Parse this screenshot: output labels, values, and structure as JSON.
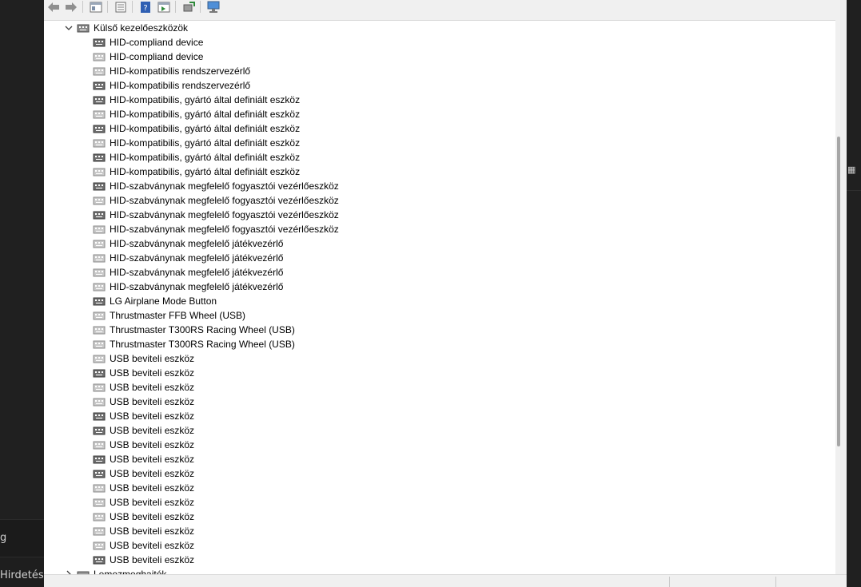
{
  "background": {
    "left_text_1": "g",
    "left_text_2": "Hirdetés"
  },
  "toolbar": {
    "buttons": [
      "back-icon",
      "forward-icon",
      "console-tree-icon",
      "properties-icon",
      "help-icon",
      "action-pane-icon",
      "scan-hardware-icon",
      "monitor-icon"
    ]
  },
  "tree": {
    "category": {
      "label": "Külső kezelőeszközök",
      "expanded": true
    },
    "devices": [
      {
        "label": "HID-compliand device",
        "icon": "dark"
      },
      {
        "label": "HID-compliand device",
        "icon": "light"
      },
      {
        "label": "HID-kompatibilis rendszervezérlő",
        "icon": "light"
      },
      {
        "label": "HID-kompatibilis rendszervezérlő",
        "icon": "dark"
      },
      {
        "label": "HID-kompatibilis, gyártó által definiált eszköz",
        "icon": "dark"
      },
      {
        "label": "HID-kompatibilis, gyártó által definiált eszköz",
        "icon": "light"
      },
      {
        "label": "HID-kompatibilis, gyártó által definiált eszköz",
        "icon": "dark"
      },
      {
        "label": "HID-kompatibilis, gyártó által definiált eszköz",
        "icon": "light"
      },
      {
        "label": "HID-kompatibilis, gyártó által definiált eszköz",
        "icon": "dark"
      },
      {
        "label": "HID-kompatibilis, gyártó által definiált eszköz",
        "icon": "light"
      },
      {
        "label": "HID-szabványnak megfelelő fogyasztói vezérlőeszköz",
        "icon": "dark"
      },
      {
        "label": "HID-szabványnak megfelelő fogyasztói vezérlőeszköz",
        "icon": "light"
      },
      {
        "label": "HID-szabványnak megfelelő fogyasztói vezérlőeszköz",
        "icon": "dark"
      },
      {
        "label": "HID-szabványnak megfelelő fogyasztói vezérlőeszköz",
        "icon": "light"
      },
      {
        "label": "HID-szabványnak megfelelő játékvezérlő",
        "icon": "light"
      },
      {
        "label": "HID-szabványnak megfelelő játékvezérlő",
        "icon": "light"
      },
      {
        "label": "HID-szabványnak megfelelő játékvezérlő",
        "icon": "light"
      },
      {
        "label": "HID-szabványnak megfelelő játékvezérlő",
        "icon": "light"
      },
      {
        "label": "LG Airplane Mode Button",
        "icon": "dark"
      },
      {
        "label": "Thrustmaster FFB Wheel (USB)",
        "icon": "light"
      },
      {
        "label": "Thrustmaster T300RS Racing Wheel  (USB)",
        "icon": "light"
      },
      {
        "label": "Thrustmaster T300RS Racing Wheel  (USB)",
        "icon": "light"
      },
      {
        "label": "USB beviteli eszköz",
        "icon": "light"
      },
      {
        "label": "USB beviteli eszköz",
        "icon": "dark"
      },
      {
        "label": "USB beviteli eszköz",
        "icon": "light"
      },
      {
        "label": "USB beviteli eszköz",
        "icon": "light"
      },
      {
        "label": "USB beviteli eszköz",
        "icon": "dark"
      },
      {
        "label": "USB beviteli eszköz",
        "icon": "dark"
      },
      {
        "label": "USB beviteli eszköz",
        "icon": "light"
      },
      {
        "label": "USB beviteli eszköz",
        "icon": "dark"
      },
      {
        "label": "USB beviteli eszköz",
        "icon": "dark"
      },
      {
        "label": "USB beviteli eszköz",
        "icon": "light"
      },
      {
        "label": "USB beviteli eszköz",
        "icon": "light"
      },
      {
        "label": "USB beviteli eszköz",
        "icon": "light"
      },
      {
        "label": "USB beviteli eszköz",
        "icon": "light"
      },
      {
        "label": "USB beviteli eszköz",
        "icon": "light"
      },
      {
        "label": "USB beviteli eszköz",
        "icon": "dark"
      }
    ],
    "next_category_label": "Lemezmeghajtók"
  }
}
